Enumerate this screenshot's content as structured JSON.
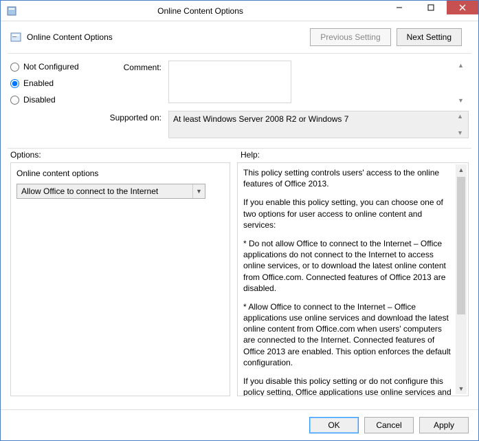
{
  "title": "Online Content Options",
  "header": {
    "title": "Online Content Options",
    "prev_label": "Previous Setting",
    "next_label": "Next Setting"
  },
  "radios": {
    "not_configured": "Not Configured",
    "enabled": "Enabled",
    "disabled": "Disabled",
    "selected": "enabled"
  },
  "fields": {
    "comment_label": "Comment:",
    "comment_value": "",
    "supported_label": "Supported on:",
    "supported_value": "At least Windows Server 2008 R2 or Windows 7"
  },
  "labels": {
    "options": "Options:",
    "help": "Help:"
  },
  "options": {
    "title": "Online content options",
    "selected": "Allow Office to connect to the Internet"
  },
  "help": {
    "p1": "This policy setting controls users' access to the online features of Office 2013.",
    "p2": "If you enable this policy setting, you can choose one of two options for user access to online content and services:",
    "p3": "* Do not allow Office to connect to the Internet – Office applications do not connect to the Internet to access online services, or to download the latest online content from Office.com. Connected features of Office 2013 are disabled.",
    "p4": "* Allow Office to connect to the Internet – Office applications use online services and download the latest online content from Office.com when users' computers are connected to the Internet. Connected features of Office 2013 are enabled. This option enforces the default configuration.",
    "p5": "If you disable this policy setting or do not configure this policy setting, Office applications use online services and download the latest online content from Office.com when users' computers are connected to the Internet. Users can change this behavior by"
  },
  "footer": {
    "ok": "OK",
    "cancel": "Cancel",
    "apply": "Apply"
  }
}
